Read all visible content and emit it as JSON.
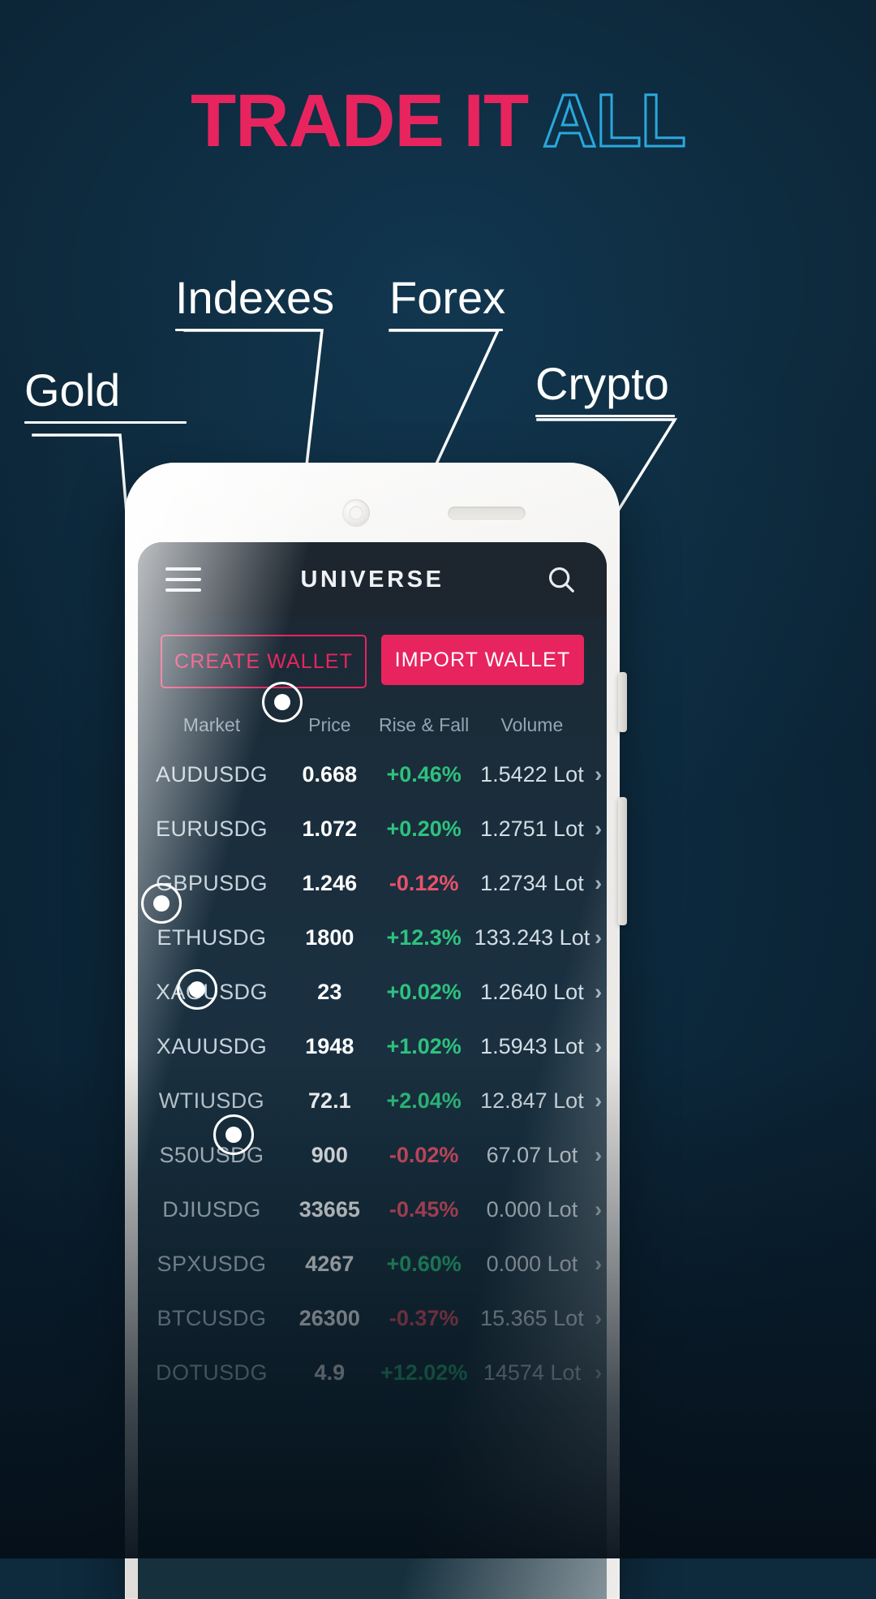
{
  "headline": {
    "solid": "TRADE IT",
    "outline": "ALL"
  },
  "callouts": [
    {
      "id": "gold",
      "label": "Gold"
    },
    {
      "id": "indexes",
      "label": "Indexes"
    },
    {
      "id": "forex",
      "label": "Forex"
    },
    {
      "id": "crypto",
      "label": "Crypto"
    }
  ],
  "colors": {
    "accent_pink": "#e8245f",
    "accent_cyan": "#2aa8dd",
    "up_green": "#2ec27e",
    "down_red": "#e8526a",
    "background": "#0e2a3d"
  },
  "phone": {
    "appbar": {
      "menu_icon": "hamburger-icon",
      "title": "UNIVERSE",
      "search_icon": "search-icon"
    },
    "wallet_buttons": {
      "create": "CREATE WALLET",
      "import": "IMPORT WALLET"
    },
    "table": {
      "headers": [
        "Market",
        "Price",
        "Rise & Fall",
        "Volume"
      ],
      "rows": [
        {
          "market": "AUDUSDG",
          "price": "0.668",
          "change": "+0.46%",
          "dir": "up",
          "volume": "1.5422 Lot",
          "arrow": "›"
        },
        {
          "market": "EURUSDG",
          "price": "1.072",
          "change": "+0.20%",
          "dir": "up",
          "volume": "1.2751 Lot",
          "arrow": "›"
        },
        {
          "market": "GBPUSDG",
          "price": "1.246",
          "change": "-0.12%",
          "dir": "down",
          "volume": "1.2734 Lot",
          "arrow": "›"
        },
        {
          "market": "ETHUSDG",
          "price": "1800",
          "change": "+12.3%",
          "dir": "up",
          "volume": "133.243 Lot",
          "arrow": "›"
        },
        {
          "market": "XAGUSDG",
          "price": "23",
          "change": "+0.02%",
          "dir": "up",
          "volume": "1.2640 Lot",
          "arrow": "›"
        },
        {
          "market": "XAUUSDG",
          "price": "1948",
          "change": "+1.02%",
          "dir": "up",
          "volume": "1.5943 Lot",
          "arrow": "›"
        },
        {
          "market": "WTIUSDG",
          "price": "72.1",
          "change": "+2.04%",
          "dir": "up",
          "volume": "12.847 Lot",
          "arrow": "›"
        },
        {
          "market": "S50USDG",
          "price": "900",
          "change": "-0.02%",
          "dir": "down",
          "volume": "67.07 Lot",
          "arrow": "›"
        },
        {
          "market": "DJIUSDG",
          "price": "33665",
          "change": "-0.45%",
          "dir": "down",
          "volume": "0.000 Lot",
          "arrow": "›"
        },
        {
          "market": "SPXUSDG",
          "price": "4267",
          "change": "+0.60%",
          "dir": "up",
          "volume": "0.000 Lot",
          "arrow": "›"
        },
        {
          "market": "BTCUSDG",
          "price": "26300",
          "change": "-0.37%",
          "dir": "down",
          "volume": "15.365 Lot",
          "arrow": "›"
        },
        {
          "market": "DOTUSDG",
          "price": "4.9",
          "change": "+12.02%",
          "dir": "up",
          "volume": "14574 Lot",
          "arrow": "›"
        }
      ]
    }
  }
}
